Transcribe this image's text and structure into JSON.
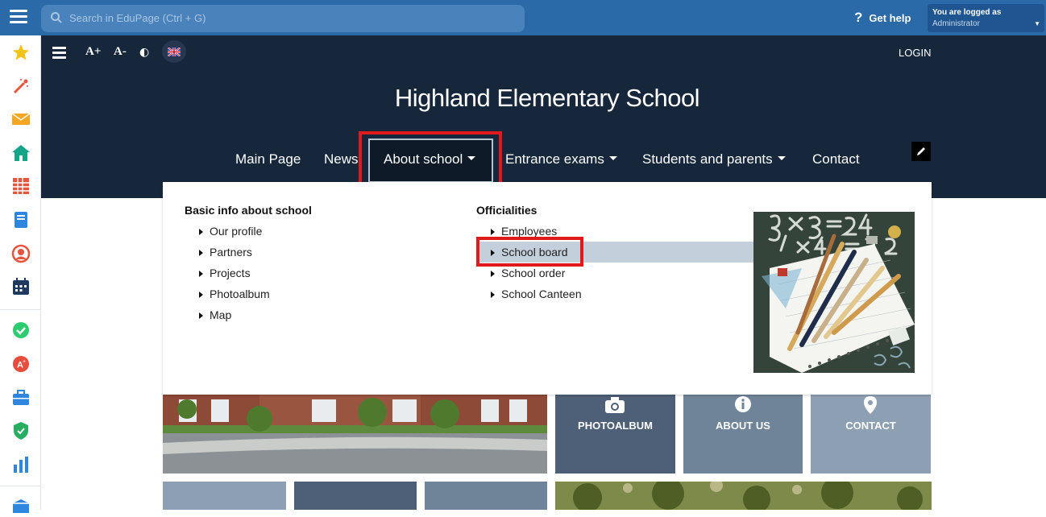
{
  "topbar": {
    "search_placeholder": "Search in EduPage (Ctrl + G)",
    "help_label": "Get help",
    "logged_line1": "You are logged as",
    "logged_line2": "Administrator"
  },
  "toolbar": {
    "font_increase": "A+",
    "font_decrease": "A-",
    "contrast": "◐",
    "login": "LOGIN"
  },
  "site": {
    "title": "Highland Elementary School"
  },
  "nav": {
    "items": [
      "Main Page",
      "News",
      "About school",
      "Entrance exams",
      "Students and parents",
      "Contact"
    ]
  },
  "dropdown": {
    "col1": {
      "heading": "Basic info about school",
      "items": [
        "Our profile",
        "Partners",
        "Projects",
        "Photoalbum",
        "Map"
      ]
    },
    "col2": {
      "heading": "Officialities",
      "items": [
        "Employees",
        "School board",
        "School order",
        "School Canteen"
      ]
    },
    "highlighted_item": "School board"
  },
  "tiles": {
    "photoalbum": "PHOTOALBUM",
    "about": "ABOUT US",
    "contact": "CONTACT"
  },
  "colors": {
    "topbar": "#2b6aa8",
    "hero": "#16273c",
    "highlight_border": "#e0191d",
    "tile_dark": "#4d6077",
    "tile_mid": "#6f8399",
    "tile_light": "#8da0b3"
  },
  "sidebar_icons": [
    "star-icon",
    "magic-wand-icon",
    "envelope-icon",
    "home-icon",
    "timetable-icon",
    "notebook-icon",
    "user-circle-icon",
    "calendar-icon",
    "check-circle-icon",
    "grade-icon",
    "briefcase-icon",
    "shield-check-icon",
    "bar-chart-icon",
    "box-icon"
  ]
}
